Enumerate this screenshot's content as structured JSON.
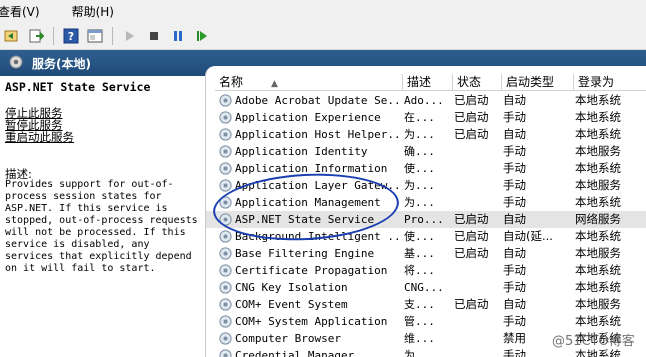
{
  "menubar": {
    "view": "查看(V)",
    "help": "帮助(H)"
  },
  "header": {
    "title": "服务(本地)"
  },
  "detail": {
    "service_name": "ASP.NET State Service",
    "actions": [
      "停止此服务",
      "暂停此服务",
      "重启动此服务"
    ],
    "description_label": "描述:",
    "description": "Provides support for out-of-\nprocess session states for\nASP.NET. If this service is\nstopped, out-of-process requests\nwill not be processed. If this\nservice is disabled, any\nservices that explicitly depend\non it will fail to start."
  },
  "columns": {
    "name": "名称",
    "description": "描述",
    "status": "状态",
    "startup": "启动类型",
    "logon": "登录为"
  },
  "services": [
    {
      "name": "Adobe Acrobat Update Se...",
      "description": "Ado...",
      "status": "已启动",
      "startup": "自动",
      "logon": "本地系统"
    },
    {
      "name": "Application Experience",
      "description": "在...",
      "status": "已启动",
      "startup": "手动",
      "logon": "本地系统"
    },
    {
      "name": "Application Host Helper...",
      "description": "为...",
      "status": "已启动",
      "startup": "自动",
      "logon": "本地系统"
    },
    {
      "name": "Application Identity",
      "description": "确...",
      "status": "",
      "startup": "手动",
      "logon": "本地服务"
    },
    {
      "name": "Application Information",
      "description": "使...",
      "status": "",
      "startup": "手动",
      "logon": "本地系统"
    },
    {
      "name": "Application Layer Gatew...",
      "description": "为...",
      "status": "",
      "startup": "手动",
      "logon": "本地服务"
    },
    {
      "name": "Application Management",
      "description": "为...",
      "status": "",
      "startup": "手动",
      "logon": "本地系统"
    },
    {
      "name": "ASP.NET State Service",
      "description": "Pro...",
      "status": "已启动",
      "startup": "自动",
      "logon": "网络服务"
    },
    {
      "name": "Background Intelligent ...",
      "description": "使...",
      "status": "已启动",
      "startup": "自动(延...",
      "logon": "本地系统"
    },
    {
      "name": "Base Filtering Engine",
      "description": "基...",
      "status": "已启动",
      "startup": "自动",
      "logon": "本地服务"
    },
    {
      "name": "Certificate Propagation",
      "description": "将...",
      "status": "",
      "startup": "手动",
      "logon": "本地系统"
    },
    {
      "name": "CNG Key Isolation",
      "description": "CNG...",
      "status": "",
      "startup": "手动",
      "logon": "本地系统"
    },
    {
      "name": "COM+ Event System",
      "description": "支...",
      "status": "已启动",
      "startup": "自动",
      "logon": "本地服务"
    },
    {
      "name": "COM+ System Application",
      "description": "管...",
      "status": "",
      "startup": "手动",
      "logon": "本地系统"
    },
    {
      "name": "Computer Browser",
      "description": "维...",
      "status": "",
      "startup": "禁用",
      "logon": "本地系统"
    },
    {
      "name": "Credential Manager",
      "description": "为...",
      "status": "",
      "startup": "手动",
      "logon": "本地系统"
    }
  ],
  "watermark": "@51CTO博客",
  "colors": {
    "header_band": "#2f5f8f",
    "annotation": "#1a3fb0",
    "selected_row": "#e4e4e4"
  }
}
